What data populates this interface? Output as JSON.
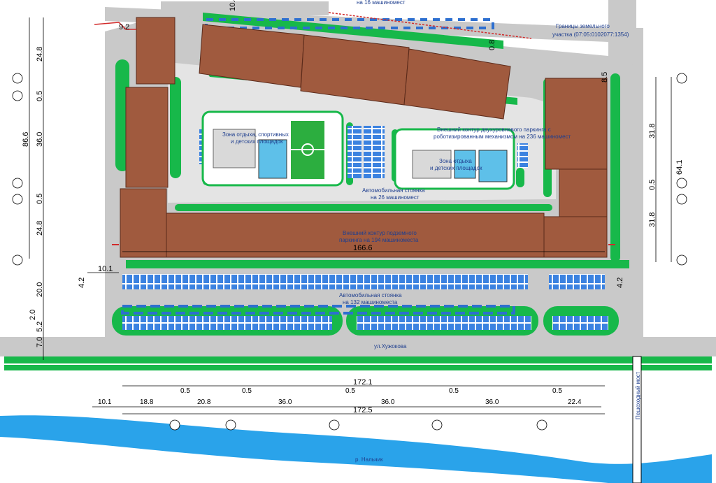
{
  "labels": {
    "parking_16": "на 16 машиномест",
    "land_boundary_1": "Границы земельного",
    "land_boundary_2": "участка (07:05:0102077:1354)",
    "zone_sport_1": "Зона отдыха, спортивных",
    "zone_sport_2": "и детских площадок",
    "garage_outline_1": "Внешний контур двухуровневого паркинга с",
    "garage_outline_2": "роботизированным механизмом на 236 машиномест",
    "zone_kids_1": "Зона отдыха",
    "zone_kids_2": "и детских площадок",
    "parking_26_1": "Автомобильная стоянка",
    "parking_26_2": "на 26 машиномест",
    "garage_under_1": "Внешний контур подземного",
    "garage_under_2": "паркинга на 194 машиноместа",
    "parking_132_1": "Автомобильная стоянка",
    "parking_132_2": "на 132 машиноместа",
    "street": "ул.Хужокова",
    "river": "р. Нальчик",
    "bridge": "Пешеходный мост"
  },
  "dims_left": [
    "24.8",
    "0.5",
    "36.0",
    "86.6",
    "0.5",
    "24.8",
    "20.0",
    "4.2",
    "2.0",
    "5.2",
    "7.0"
  ],
  "dims_right": [
    "8.5",
    "31.8",
    "0.5",
    "64.1",
    "31.8",
    "4.2"
  ],
  "dims_top": [
    "9.2",
    "10.4",
    "0.8"
  ],
  "dim_main": "166.6",
  "dim_left_offset": "10.1",
  "dims_bottom_row1": [
    "10.1",
    "18.8",
    "0.5",
    "20.8",
    "0.5",
    "36.0",
    "0.5",
    "36.0",
    "0.5",
    "36.0",
    "0.5",
    "22.4"
  ],
  "dim_total_1": "172.1",
  "dim_total_2": "172.5",
  "colors": {
    "building": "#a05a3e",
    "green": "#17b84a",
    "road": "#c9c9c9",
    "parking": "#2d6fd0",
    "river": "#2aa3ea",
    "border_red": "#d12a2a"
  }
}
